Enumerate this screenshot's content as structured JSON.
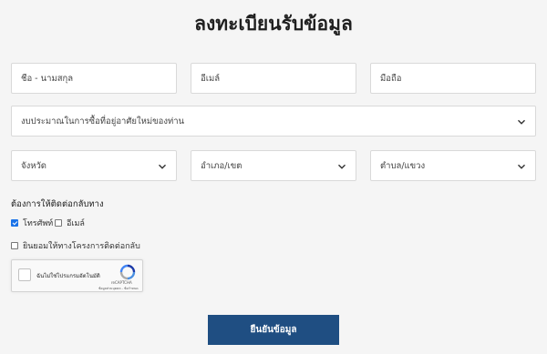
{
  "form": {
    "title": "ลงทะเบียนรับข้อมูล",
    "name_placeholder": "ชื่อ - นามสกุล",
    "email_placeholder": "อีเมล์",
    "phone_placeholder": "มือถือ",
    "budget_select": "งบประมาณในการซื้อที่อยู่อาศัยใหม่ของท่าน",
    "province_select": "จังหวัด",
    "district_select": "อำเภอ/เขต",
    "subdistrict_select": "ตำบล/แขวง",
    "contact_label": "ต้องการให้ติดต่อกลับทาง",
    "contact_options": [
      {
        "label": "โทรศัพท์",
        "checked": true
      },
      {
        "label": "อีเมล์",
        "checked": false
      }
    ],
    "consent_label": "ยินยอมให้ทางโครงการติดต่อกลับ",
    "consent_checked": false,
    "submit_label": "ยืนยันข้อมูล"
  },
  "recaptcha": {
    "label": "ฉันไม่ใช่โปรแกรมอัตโนมัติ",
    "brand": "reCAPTCHA",
    "links": "ข้อมูลส่วนบุคคล - ข้อกำหนด"
  },
  "colors": {
    "background": "#f5f5f5",
    "submit_bg": "#1f4e82",
    "checkbox_checked": "#1a73e8"
  }
}
